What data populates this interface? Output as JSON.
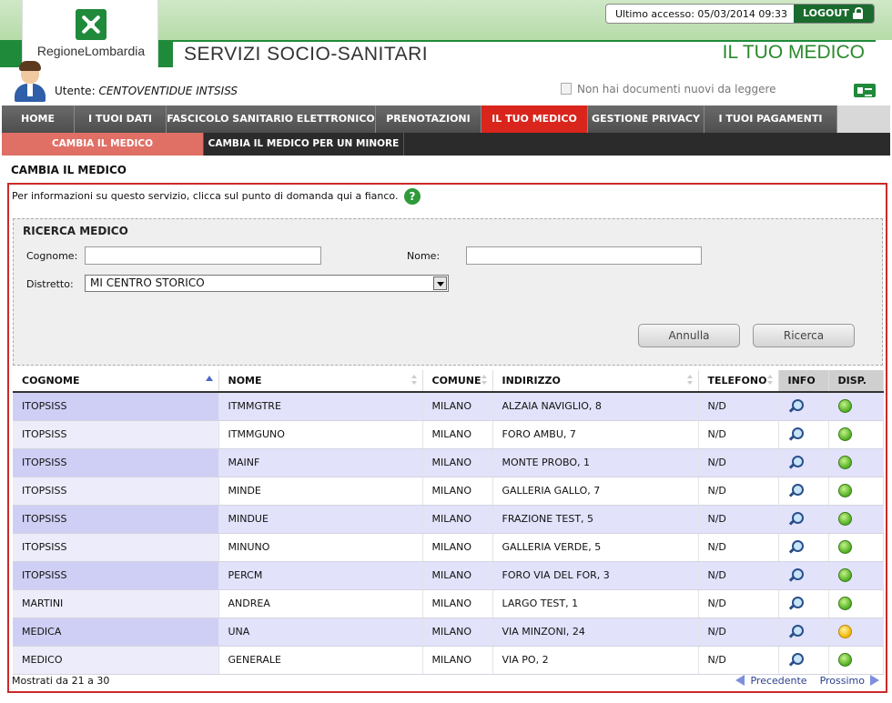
{
  "header": {
    "brand": "RegioneLombardia",
    "last_access": "Ultimo accesso: 05/03/2014 09:33",
    "logout_label": "LOGOUT",
    "service_title": "SERVIZI SOCIO-SANITARI",
    "section_title": "IL TUO MEDICO"
  },
  "user": {
    "label": "Utente:",
    "name": "CENTOVENTIDUE INTSISS",
    "docs_notice": "Non hai documenti nuovi da leggere"
  },
  "nav": {
    "items": [
      {
        "label": "HOME"
      },
      {
        "label": "I TUOI DATI"
      },
      {
        "label": "FASCICOLO SANITARIO ELETTRONICO"
      },
      {
        "label": "PRENOTAZIONI"
      },
      {
        "label": "IL TUO MEDICO"
      },
      {
        "label": "GESTIONE PRIVACY"
      },
      {
        "label": "I TUOI PAGAMENTI"
      }
    ],
    "active_index": 4
  },
  "subnav": {
    "items": [
      {
        "label": "CAMBIA IL MEDICO"
      },
      {
        "label": "CAMBIA IL MEDICO PER UN MINORE"
      }
    ]
  },
  "page": {
    "title": "CAMBIA IL MEDICO",
    "info": "Per informazioni su questo servizio, clicca sul punto di domanda qui a fianco.",
    "help": "?"
  },
  "search": {
    "title": "RICERCA MEDICO",
    "cognome_label": "Cognome:",
    "cognome_value": "",
    "nome_label": "Nome:",
    "nome_value": "",
    "distretto_label": "Distretto:",
    "distretto_value": "MI CENTRO STORICO",
    "cancel_label": "Annulla",
    "search_label": "Ricerca"
  },
  "table": {
    "headers": [
      "COGNOME",
      "NOME",
      "COMUNE",
      "INDIRIZZO",
      "TELEFONO",
      "INFO",
      "DISP."
    ],
    "rows": [
      {
        "cognome": "ITOPSISS",
        "nome": "ITMMGTRE",
        "comune": "MILANO",
        "indirizzo": "ALZAIA NAVIGLIO, 8",
        "telefono": "N/D",
        "disp": "green"
      },
      {
        "cognome": "ITOPSISS",
        "nome": "ITMMGUNO",
        "comune": "MILANO",
        "indirizzo": "FORO AMBU, 7",
        "telefono": "N/D",
        "disp": "green"
      },
      {
        "cognome": "ITOPSISS",
        "nome": "MAINF",
        "comune": "MILANO",
        "indirizzo": "MONTE PROBO, 1",
        "telefono": "N/D",
        "disp": "green"
      },
      {
        "cognome": "ITOPSISS",
        "nome": "MINDE",
        "comune": "MILANO",
        "indirizzo": "GALLERIA GALLO, 7",
        "telefono": "N/D",
        "disp": "green"
      },
      {
        "cognome": "ITOPSISS",
        "nome": "MINDUE",
        "comune": "MILANO",
        "indirizzo": "FRAZIONE TEST, 5",
        "telefono": "N/D",
        "disp": "green"
      },
      {
        "cognome": "ITOPSISS",
        "nome": "MINUNO",
        "comune": "MILANO",
        "indirizzo": "GALLERIA VERDE, 5",
        "telefono": "N/D",
        "disp": "green"
      },
      {
        "cognome": "ITOPSISS",
        "nome": "PERCM",
        "comune": "MILANO",
        "indirizzo": "FORO VIA DEL FOR, 3",
        "telefono": "N/D",
        "disp": "green"
      },
      {
        "cognome": "MARTINI",
        "nome": "ANDREA",
        "comune": "MILANO",
        "indirizzo": "LARGO TEST, 1",
        "telefono": "N/D",
        "disp": "green"
      },
      {
        "cognome": "MEDICA",
        "nome": "UNA",
        "comune": "MILANO",
        "indirizzo": "VIA MINZONI, 24",
        "telefono": "N/D",
        "disp": "yellow"
      },
      {
        "cognome": "MEDICO",
        "nome": "GENERALE",
        "comune": "MILANO",
        "indirizzo": "VIA PO, 2",
        "telefono": "N/D",
        "disp": "green"
      }
    ]
  },
  "footer": {
    "shown": "Mostrati da 21 a 30",
    "prev_label": "Precedente",
    "next_label": "Prossimo"
  },
  "colors": {
    "brand_green": "#1f8a3a",
    "active_red": "#d9251c",
    "frame_red": "#cc2a2a"
  }
}
